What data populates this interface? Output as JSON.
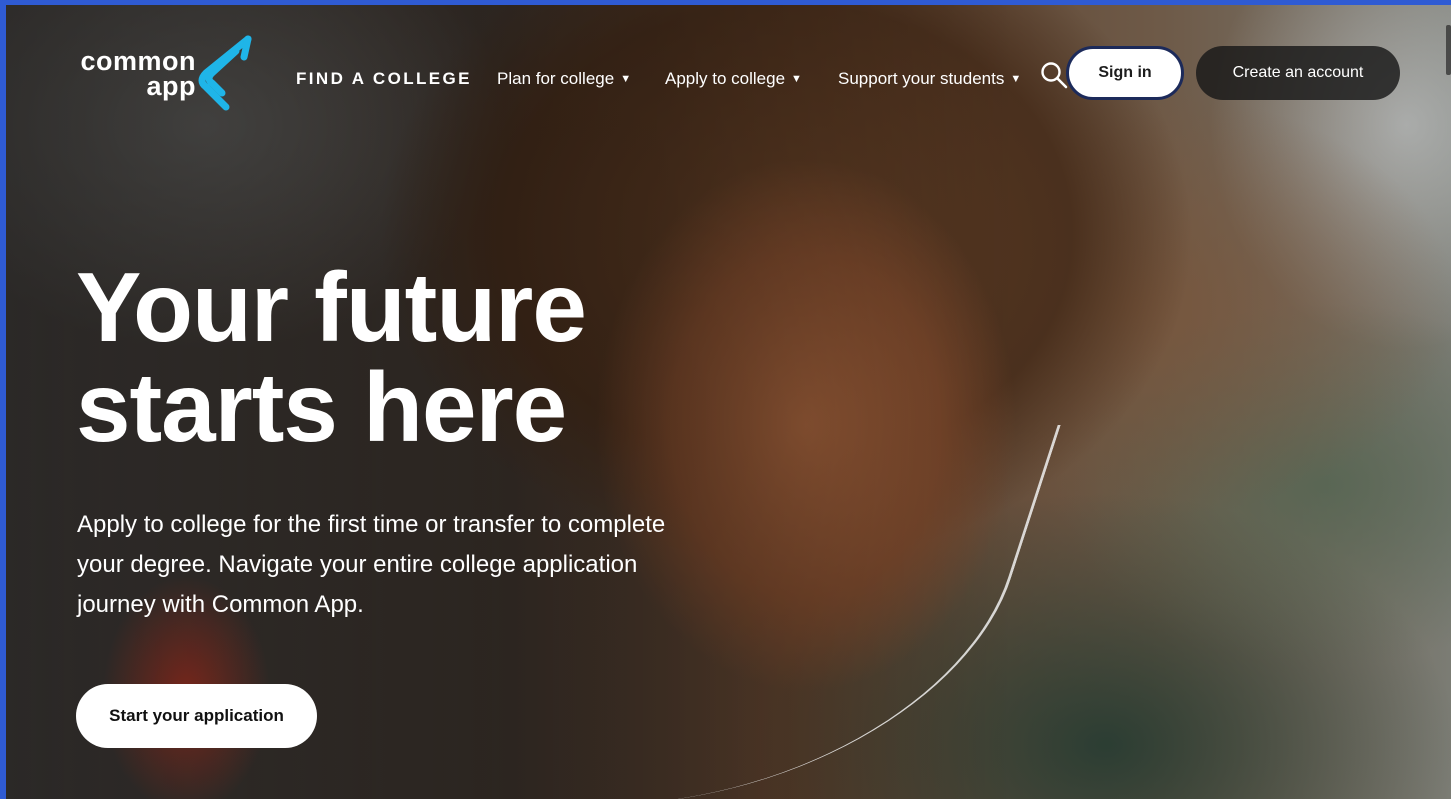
{
  "logo": {
    "line1": "common",
    "line2": "app",
    "mark_color": "#1fb5e8"
  },
  "nav": {
    "items": [
      {
        "label": "FIND A COLLEGE",
        "has_dropdown": false
      },
      {
        "label": "Plan for college",
        "has_dropdown": true
      },
      {
        "label": "Apply to college",
        "has_dropdown": true
      },
      {
        "label": "Support your students",
        "has_dropdown": true
      }
    ],
    "dropdown_icon": "caret-down-icon",
    "search_icon": "search-icon"
  },
  "auth": {
    "sign_in": "Sign in",
    "create_account": "Create an account"
  },
  "hero": {
    "title_line1": "Your future",
    "title_line2": "starts here",
    "subtitle": "Apply to college for the first time or transfer to complete your degree. Navigate your entire college application journey with Common App.",
    "cta": "Start your application"
  },
  "colors": {
    "frame_border": "#2f5bd3",
    "signin_border": "#1c2a5a",
    "brand_accent": "#1fb5e8"
  }
}
